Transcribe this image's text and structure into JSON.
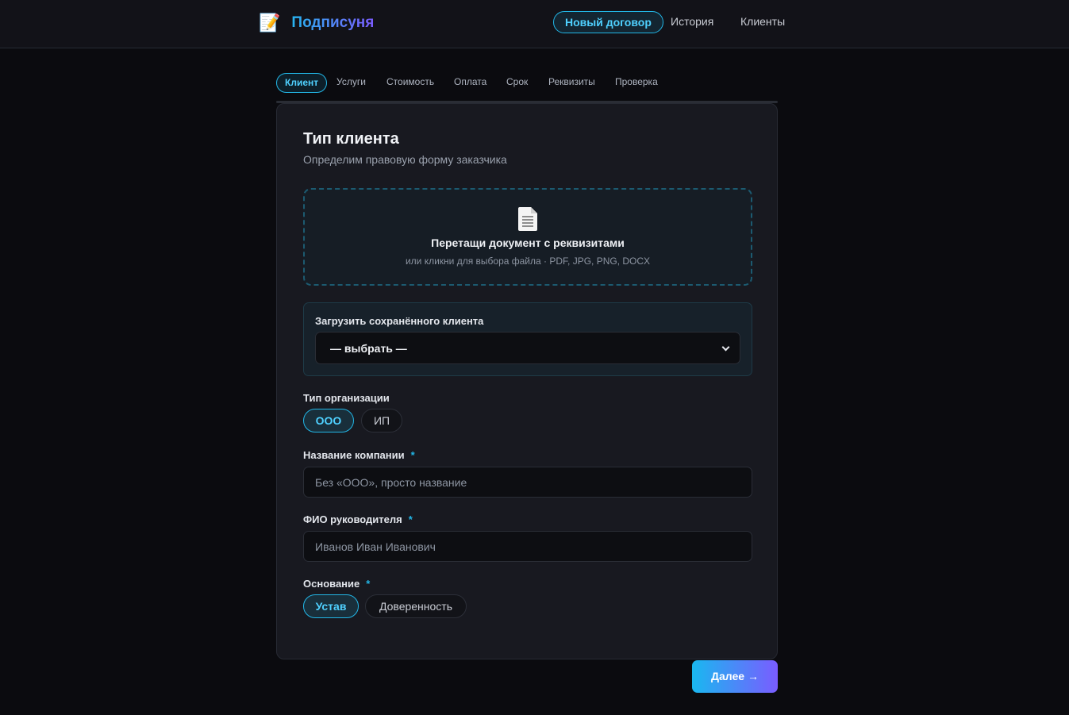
{
  "app": {
    "logo_icon": "memo-icon",
    "title": "Подписуня"
  },
  "nav": {
    "items": [
      {
        "label": "Новый договор",
        "active": true
      },
      {
        "label": "История",
        "active": false
      },
      {
        "label": "Клиенты",
        "active": false
      }
    ]
  },
  "steps": [
    {
      "label": "Клиент",
      "active": true
    },
    {
      "label": "Услуги",
      "active": false
    },
    {
      "label": "Стоимость",
      "active": false
    },
    {
      "label": "Оплата",
      "active": false
    },
    {
      "label": "Срок",
      "active": false
    },
    {
      "label": "Реквизиты",
      "active": false
    },
    {
      "label": "Проверка",
      "active": false
    }
  ],
  "card": {
    "title": "Тип клиента",
    "subtitle": "Определим правовую форму заказчика"
  },
  "dropzone": {
    "icon": "document-icon",
    "title": "Перетащи документ с реквизитами",
    "subtitle": "или кликни для выбора файла · PDF, JPG, PNG, DOCX"
  },
  "saved_client": {
    "label": "Загрузить сохранённого клиента",
    "selected": "— выбрать —"
  },
  "org_type": {
    "label": "Тип организации",
    "options": [
      "ООО",
      "ИП"
    ],
    "selected": "ООО"
  },
  "company_name": {
    "label": "Название компании",
    "required_mark": "*",
    "placeholder": "Без «ООО», просто название",
    "value": ""
  },
  "director_name": {
    "label": "ФИО руководителя",
    "required_mark": "*",
    "placeholder": "Иванов Иван Иванович",
    "value": ""
  },
  "basis": {
    "label": "Основание",
    "required_mark": "*",
    "options": [
      "Устав",
      "Доверенность"
    ],
    "selected": "Устав"
  },
  "footer": {
    "next_label": "Далее →"
  },
  "colors": {
    "accent": "#22b6e6",
    "accent_secondary": "#7a5cff",
    "background": "#0b0b0f",
    "card": "#181920"
  }
}
